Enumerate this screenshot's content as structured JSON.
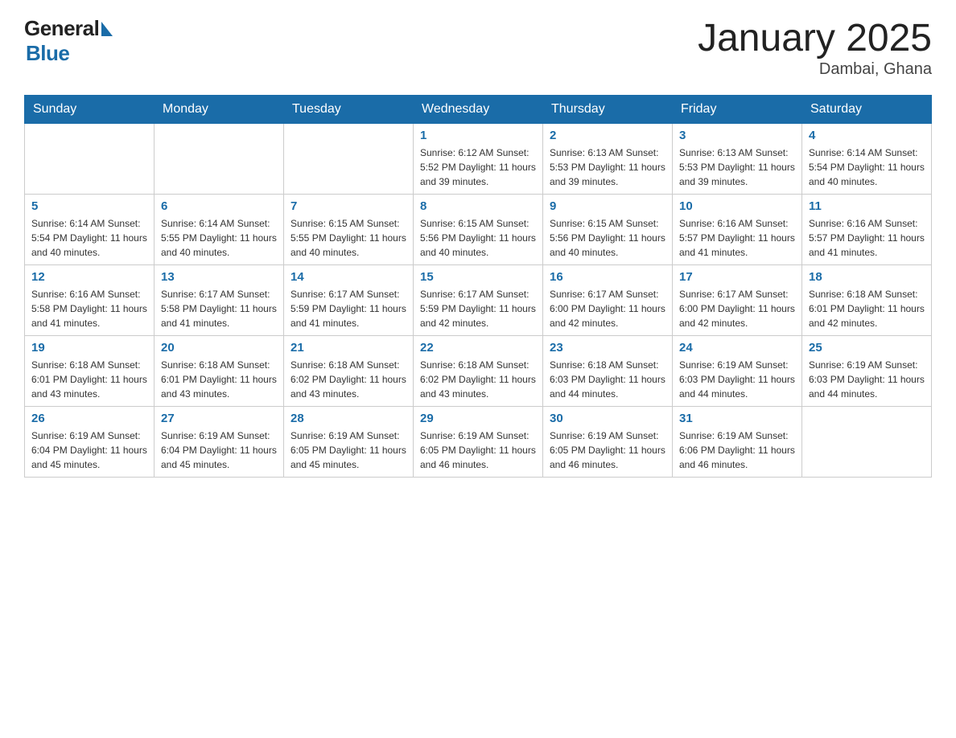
{
  "header": {
    "title": "January 2025",
    "subtitle": "Dambai, Ghana"
  },
  "weekdays": [
    "Sunday",
    "Monday",
    "Tuesday",
    "Wednesday",
    "Thursday",
    "Friday",
    "Saturday"
  ],
  "weeks": [
    [
      {
        "day": "",
        "info": ""
      },
      {
        "day": "",
        "info": ""
      },
      {
        "day": "",
        "info": ""
      },
      {
        "day": "1",
        "info": "Sunrise: 6:12 AM\nSunset: 5:52 PM\nDaylight: 11 hours and 39 minutes."
      },
      {
        "day": "2",
        "info": "Sunrise: 6:13 AM\nSunset: 5:53 PM\nDaylight: 11 hours and 39 minutes."
      },
      {
        "day": "3",
        "info": "Sunrise: 6:13 AM\nSunset: 5:53 PM\nDaylight: 11 hours and 39 minutes."
      },
      {
        "day": "4",
        "info": "Sunrise: 6:14 AM\nSunset: 5:54 PM\nDaylight: 11 hours and 40 minutes."
      }
    ],
    [
      {
        "day": "5",
        "info": "Sunrise: 6:14 AM\nSunset: 5:54 PM\nDaylight: 11 hours and 40 minutes."
      },
      {
        "day": "6",
        "info": "Sunrise: 6:14 AM\nSunset: 5:55 PM\nDaylight: 11 hours and 40 minutes."
      },
      {
        "day": "7",
        "info": "Sunrise: 6:15 AM\nSunset: 5:55 PM\nDaylight: 11 hours and 40 minutes."
      },
      {
        "day": "8",
        "info": "Sunrise: 6:15 AM\nSunset: 5:56 PM\nDaylight: 11 hours and 40 minutes."
      },
      {
        "day": "9",
        "info": "Sunrise: 6:15 AM\nSunset: 5:56 PM\nDaylight: 11 hours and 40 minutes."
      },
      {
        "day": "10",
        "info": "Sunrise: 6:16 AM\nSunset: 5:57 PM\nDaylight: 11 hours and 41 minutes."
      },
      {
        "day": "11",
        "info": "Sunrise: 6:16 AM\nSunset: 5:57 PM\nDaylight: 11 hours and 41 minutes."
      }
    ],
    [
      {
        "day": "12",
        "info": "Sunrise: 6:16 AM\nSunset: 5:58 PM\nDaylight: 11 hours and 41 minutes."
      },
      {
        "day": "13",
        "info": "Sunrise: 6:17 AM\nSunset: 5:58 PM\nDaylight: 11 hours and 41 minutes."
      },
      {
        "day": "14",
        "info": "Sunrise: 6:17 AM\nSunset: 5:59 PM\nDaylight: 11 hours and 41 minutes."
      },
      {
        "day": "15",
        "info": "Sunrise: 6:17 AM\nSunset: 5:59 PM\nDaylight: 11 hours and 42 minutes."
      },
      {
        "day": "16",
        "info": "Sunrise: 6:17 AM\nSunset: 6:00 PM\nDaylight: 11 hours and 42 minutes."
      },
      {
        "day": "17",
        "info": "Sunrise: 6:17 AM\nSunset: 6:00 PM\nDaylight: 11 hours and 42 minutes."
      },
      {
        "day": "18",
        "info": "Sunrise: 6:18 AM\nSunset: 6:01 PM\nDaylight: 11 hours and 42 minutes."
      }
    ],
    [
      {
        "day": "19",
        "info": "Sunrise: 6:18 AM\nSunset: 6:01 PM\nDaylight: 11 hours and 43 minutes."
      },
      {
        "day": "20",
        "info": "Sunrise: 6:18 AM\nSunset: 6:01 PM\nDaylight: 11 hours and 43 minutes."
      },
      {
        "day": "21",
        "info": "Sunrise: 6:18 AM\nSunset: 6:02 PM\nDaylight: 11 hours and 43 minutes."
      },
      {
        "day": "22",
        "info": "Sunrise: 6:18 AM\nSunset: 6:02 PM\nDaylight: 11 hours and 43 minutes."
      },
      {
        "day": "23",
        "info": "Sunrise: 6:18 AM\nSunset: 6:03 PM\nDaylight: 11 hours and 44 minutes."
      },
      {
        "day": "24",
        "info": "Sunrise: 6:19 AM\nSunset: 6:03 PM\nDaylight: 11 hours and 44 minutes."
      },
      {
        "day": "25",
        "info": "Sunrise: 6:19 AM\nSunset: 6:03 PM\nDaylight: 11 hours and 44 minutes."
      }
    ],
    [
      {
        "day": "26",
        "info": "Sunrise: 6:19 AM\nSunset: 6:04 PM\nDaylight: 11 hours and 45 minutes."
      },
      {
        "day": "27",
        "info": "Sunrise: 6:19 AM\nSunset: 6:04 PM\nDaylight: 11 hours and 45 minutes."
      },
      {
        "day": "28",
        "info": "Sunrise: 6:19 AM\nSunset: 6:05 PM\nDaylight: 11 hours and 45 minutes."
      },
      {
        "day": "29",
        "info": "Sunrise: 6:19 AM\nSunset: 6:05 PM\nDaylight: 11 hours and 46 minutes."
      },
      {
        "day": "30",
        "info": "Sunrise: 6:19 AM\nSunset: 6:05 PM\nDaylight: 11 hours and 46 minutes."
      },
      {
        "day": "31",
        "info": "Sunrise: 6:19 AM\nSunset: 6:06 PM\nDaylight: 11 hours and 46 minutes."
      },
      {
        "day": "",
        "info": ""
      }
    ]
  ]
}
